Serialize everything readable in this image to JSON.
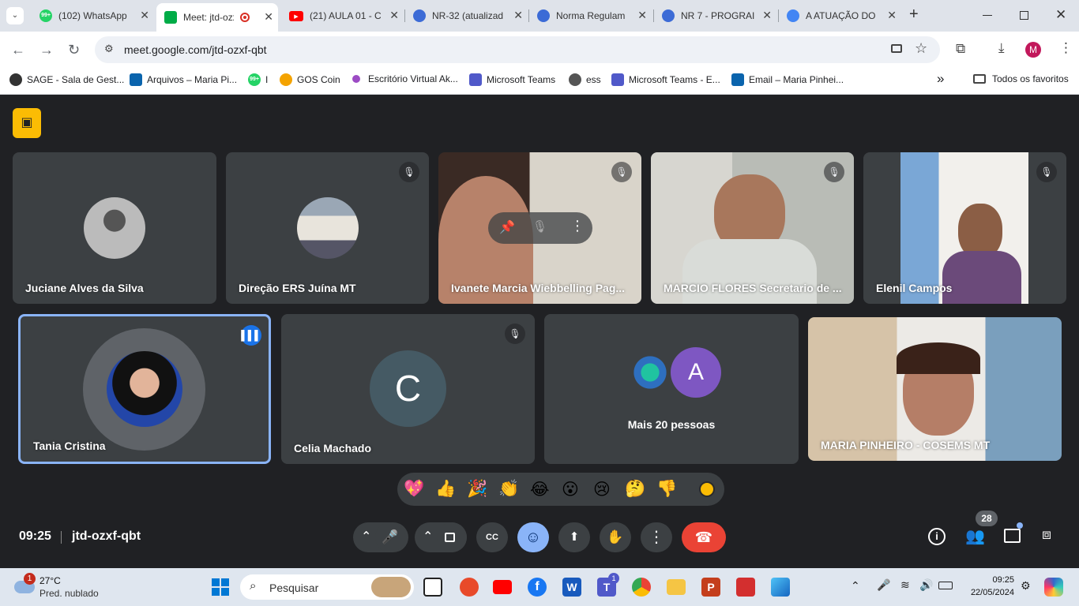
{
  "browser": {
    "tabs": [
      {
        "title": "(102) WhatsApp",
        "badge": "99+"
      },
      {
        "title": "Meet: jtd-ozxf-qbt",
        "active": true
      },
      {
        "title": "(21) AULA 01 - C"
      },
      {
        "title": "NR-32 (atualizad"
      },
      {
        "title": "Norma Regulam"
      },
      {
        "title": "NR 7 - PROGRAI"
      },
      {
        "title": "A ATUAÇÃO DO"
      }
    ],
    "new_tab": "+",
    "url": "meet.google.com/jtd-ozxf-qbt",
    "profile_initial": "M",
    "bookmarks": [
      "SAGE - Sala de Gest...",
      "Arquivos – Maria Pi...",
      "I",
      "GOS Coin",
      "Escritório Virtual Ak...",
      "Microsoft Teams",
      "ess",
      "Microsoft Teams - E...",
      "Email – Maria Pinhei..."
    ],
    "bookmarks_more": "»",
    "all_favorites": "Todos os favoritos"
  },
  "meet": {
    "participants_row1": [
      {
        "name": "Juciane Alves da Silva"
      },
      {
        "name": "Direção ERS Juína MT"
      },
      {
        "name": "Ivanete Marcia Wiebbelling Pag..."
      },
      {
        "name": "MARCIO FLORES Secretario de ..."
      },
      {
        "name": "Elenil Campos"
      }
    ],
    "participants_row2": [
      {
        "name": "Tania Cristina"
      },
      {
        "name": "Celia Machado",
        "initial": "C"
      },
      {
        "name": "Mais 20 pessoas",
        "initial": "A"
      },
      {
        "name": "MARIA PINHEIRO - COSEMS MT"
      }
    ],
    "time": "09:25",
    "meeting_code": "jtd-ozxf-qbt",
    "people_count": "28",
    "emojis": [
      "💖",
      "👍",
      "🎉",
      "👏",
      "😂",
      "😮",
      "😢",
      "🤔",
      "👎"
    ]
  },
  "taskbar": {
    "weather_temp": "27°C",
    "weather_desc": "Pred. nublado",
    "weather_badge": "1",
    "search_placeholder": "Pesquisar",
    "teams_badge": "1",
    "clock_time": "09:25",
    "clock_date": "22/05/2024"
  },
  "colors": {
    "meet_bg": "#202124",
    "tile_bg": "#3c4043",
    "speaking_border": "#8ab4f8",
    "hangup": "#ea4335",
    "reaction_active": "#8ab4f8",
    "recording_badge": "#fbbc04"
  }
}
